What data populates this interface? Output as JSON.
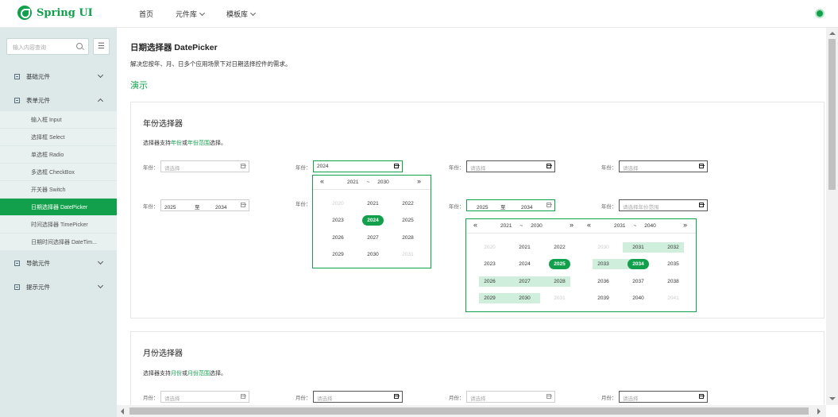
{
  "brand": {
    "name": "Spring UI"
  },
  "nav": [
    {
      "label": "首页",
      "dropdown": false
    },
    {
      "label": "元件库",
      "dropdown": true
    },
    {
      "label": "模板库",
      "dropdown": true
    }
  ],
  "sidebar": {
    "search_placeholder": "输入内容查询",
    "groups": {
      "basic": "基础元件",
      "form": "表单元件",
      "nav": "导航元件",
      "tip": "提示元件"
    },
    "form_items": [
      "输入框 Input",
      "选择框 Select",
      "单选框 Radio",
      "多选框 CheckBox",
      "开关器 Switch",
      "日期选择器 DatePicker",
      "时间选择器 TimePicker",
      "日期时间选择器 DateTim..."
    ],
    "active_item": "日期选择器 DatePicker"
  },
  "page": {
    "title": "日期选择器 DatePicker",
    "description": "解决您按年、月、日多个应用场景下对日期选择控件的需求。",
    "demo_label": "演示"
  },
  "year_card": {
    "title": "年份选择器",
    "desc_prefix": "选择器支持",
    "desc_link1": "年份",
    "desc_mid": "或",
    "desc_link2": "年份范围",
    "desc_suffix": "选择。",
    "field_label": "年份：",
    "placeholder": "请选择",
    "range_placeholder": "请选择年份范围",
    "value_2024": "2024",
    "range_start": "2025",
    "range_sep": "至",
    "range_end": "2034"
  },
  "popup1": {
    "range_start": "2021",
    "tilde": "~",
    "range_end": "2030",
    "years": [
      "2020",
      "2021",
      "2022",
      "2023",
      "2024",
      "2025",
      "2026",
      "2027",
      "2028",
      "2029",
      "2030",
      "2031"
    ]
  },
  "popup2": {
    "left": {
      "range_start": "2021",
      "tilde": "~",
      "range_end": "2030",
      "years": [
        "2020",
        "2021",
        "2022",
        "2023",
        "2024",
        "2025",
        "2026",
        "2027",
        "2028",
        "2029",
        "2030",
        "2031"
      ]
    },
    "right": {
      "range_start": "2031",
      "tilde": "~",
      "range_end": "2040",
      "years": [
        "2030",
        "2031",
        "2032",
        "2033",
        "2034",
        "2035",
        "2036",
        "2037",
        "2038",
        "2039",
        "2040",
        "2041"
      ]
    }
  },
  "month_card": {
    "title": "月份选择器",
    "desc_prefix": "选择器支持",
    "desc_link1": "月份",
    "desc_mid": "或",
    "desc_link2": "月份范围",
    "desc_suffix": "选择。",
    "field_label": "月份：",
    "placeholder": "请选择"
  },
  "colors": {
    "accent": "#12a04c",
    "range_bg": "#cfeedb",
    "sidebar_bg": "#dde9e9"
  },
  "icons": {
    "calendar": "calendar-icon",
    "search": "search-icon",
    "menu": "menu-icon"
  }
}
